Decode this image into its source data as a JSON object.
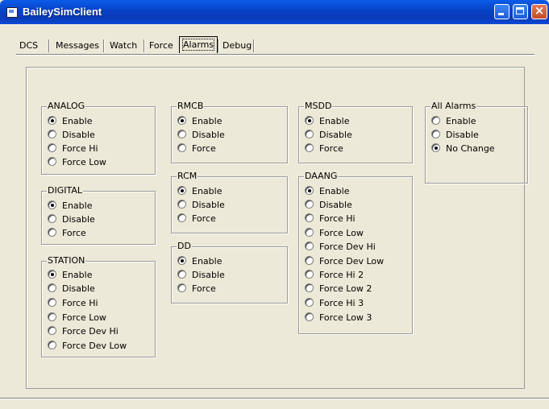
{
  "window": {
    "title": "BaileySimClient"
  },
  "tabs": [
    "DCS",
    "Messages",
    "Watch",
    "Force",
    "Alarms",
    "Debug"
  ],
  "active_tab": "Alarms",
  "groups": {
    "analog": {
      "title": "ANALOG",
      "options": [
        "Enable",
        "Disable",
        "Force Hi",
        "Force Low"
      ],
      "selected": 0
    },
    "digital": {
      "title": "DIGITAL",
      "options": [
        "Enable",
        "Disable",
        "Force"
      ],
      "selected": 0
    },
    "station": {
      "title": "STATION",
      "options": [
        "Enable",
        "Disable",
        "Force Hi",
        "Force Low",
        "Force Dev Hi",
        "Force Dev Low"
      ],
      "selected": 0
    },
    "rmcb": {
      "title": "RMCB",
      "options": [
        "Enable",
        "Disable",
        "Force"
      ],
      "selected": 0
    },
    "rcm": {
      "title": "RCM",
      "options": [
        "Enable",
        "Disable",
        "Force"
      ],
      "selected": 0
    },
    "dd": {
      "title": "DD",
      "options": [
        "Enable",
        "Disable",
        "Force"
      ],
      "selected": 0
    },
    "msdd": {
      "title": "MSDD",
      "options": [
        "Enable",
        "Disable",
        "Force"
      ],
      "selected": 0
    },
    "daang": {
      "title": "DAANG",
      "options": [
        "Enable",
        "Disable",
        "Force Hi",
        "Force Low",
        "Force Dev Hi",
        "Force Dev Low",
        "Force Hi 2",
        "Force Low 2",
        "Force Hi 3",
        "Force Low 3"
      ],
      "selected": 0
    },
    "all_alarms": {
      "title": "All Alarms",
      "options": [
        "Enable",
        "Disable",
        "No Change"
      ],
      "selected": 2
    }
  }
}
